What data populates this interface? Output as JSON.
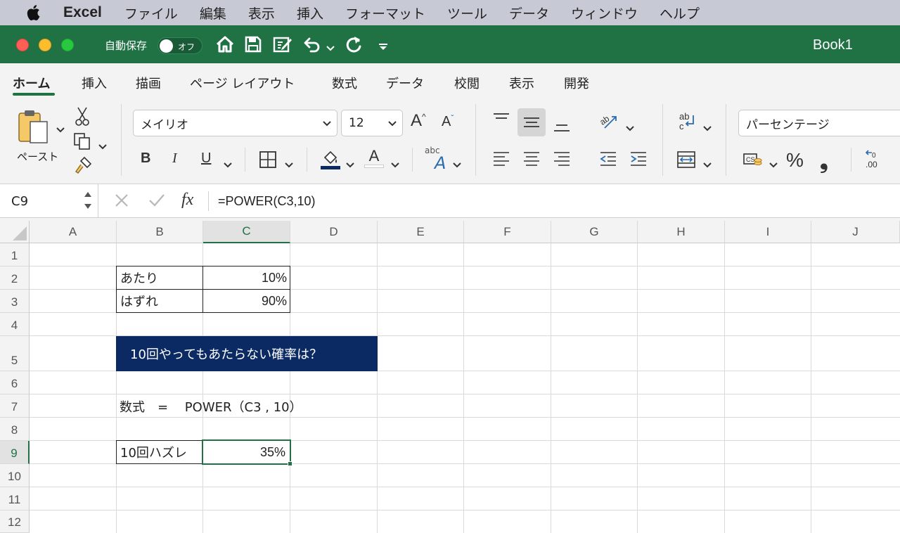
{
  "menubar": {
    "app_name": "Excel",
    "items": [
      "ファイル",
      "編集",
      "表示",
      "挿入",
      "フォーマット",
      "ツール",
      "データ",
      "ウィンドウ",
      "ヘルプ"
    ]
  },
  "titlebar": {
    "autosave_label": "自動保存",
    "toggle_label": "オフ",
    "doc_title": "Book1"
  },
  "ribbon_tabs": [
    "ホーム",
    "挿入",
    "描画",
    "ページ レイアウト",
    "数式",
    "データ",
    "校閲",
    "表示",
    "開発"
  ],
  "ribbon": {
    "paste_label": "ペースト",
    "font_name": "メイリオ",
    "font_size": "12",
    "bold": "B",
    "italic": "I",
    "underline": "U",
    "number_format": "パーセンテージ",
    "percent": "%",
    "comma": "❟",
    "grow_font": "A",
    "shrink_font": "A",
    "font_color_glyph": "A",
    "abc_glyph": "abc"
  },
  "formula_bar": {
    "name_box": "C9",
    "fx": "fx",
    "formula": "=POWER(C3,10)"
  },
  "sheet": {
    "columns": [
      "A",
      "B",
      "C",
      "D",
      "E",
      "F",
      "G",
      "H",
      "I",
      "J"
    ],
    "rows": [
      "1",
      "2",
      "3",
      "4",
      "5",
      "6",
      "7",
      "8",
      "9",
      "10",
      "11",
      "12"
    ],
    "selected_column": "C",
    "selected_row": "9",
    "cells": {
      "B2": "あたり",
      "C2": "10%",
      "B3": "はずれ",
      "C3": "90%",
      "B5": "10回やってもあたらない確率は？",
      "B7": "数式　=　 POWER（C3 , 10）",
      "B9": "10回ハズレ",
      "C9": "35%"
    }
  },
  "colors": {
    "accent": "#207245",
    "banner": "#0b2962",
    "menubar": "#c7c9d4"
  }
}
